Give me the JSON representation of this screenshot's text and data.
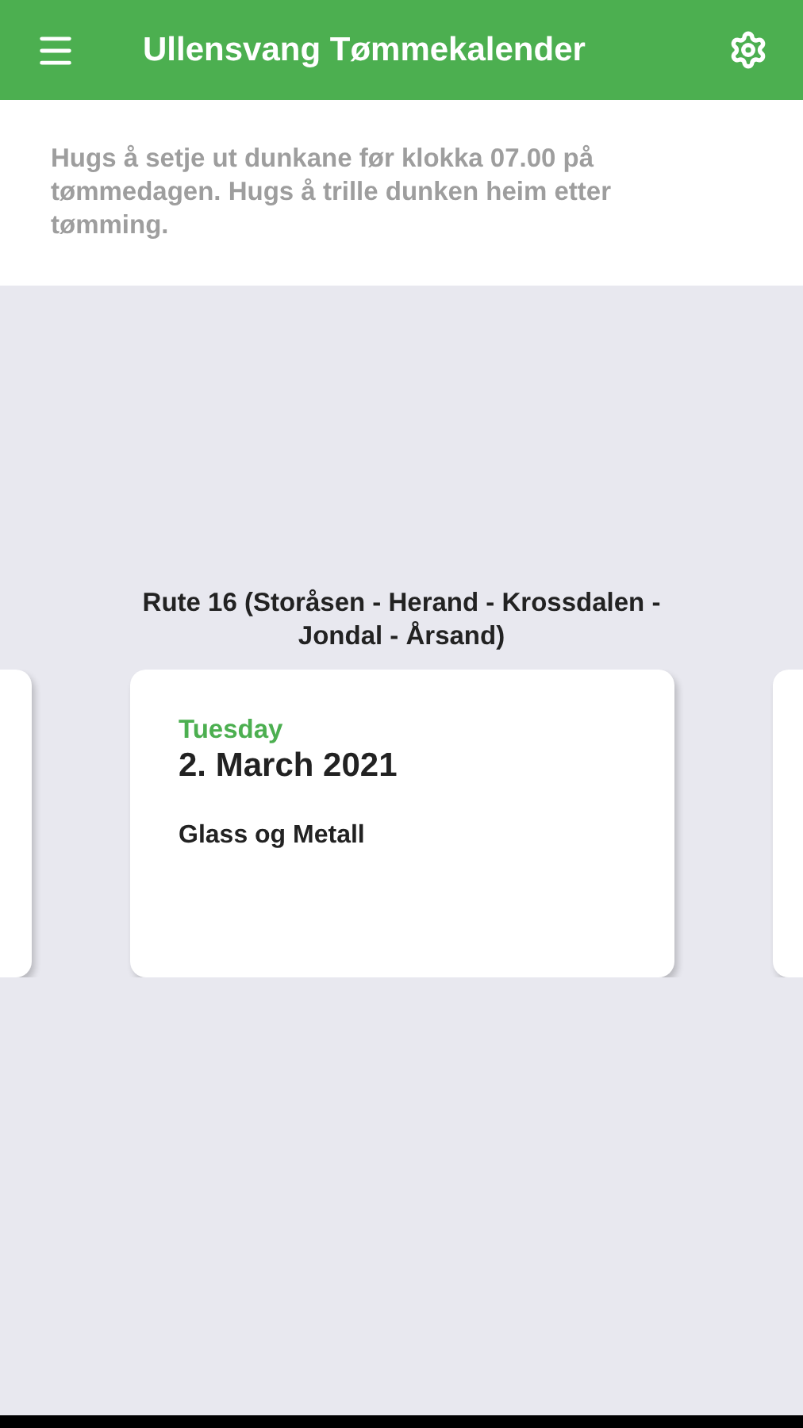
{
  "app_bar": {
    "title": "Ullensvang Tømmekalender"
  },
  "notice": "Hugs å setje ut dunkane før klokka 07.00 på tømmedagen. Hugs å trille dunken heim etter tømming.",
  "route": "Rute 16 (Storåsen - Herand - Krossdalen - Jondal - Årsand)",
  "card": {
    "weekday": "Tuesday",
    "date": "2. March 2021",
    "waste_type": "Glass og Metall"
  }
}
